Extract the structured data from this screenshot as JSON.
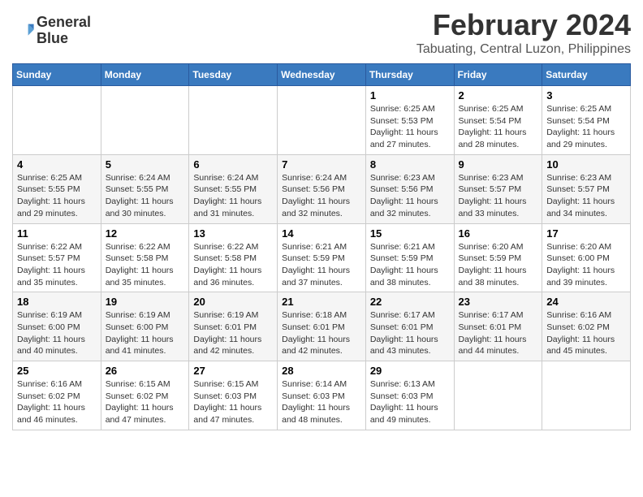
{
  "logo": {
    "line1": "General",
    "line2": "Blue"
  },
  "title": "February 2024",
  "subtitle": "Tabuating, Central Luzon, Philippines",
  "headers": [
    "Sunday",
    "Monday",
    "Tuesday",
    "Wednesday",
    "Thursday",
    "Friday",
    "Saturday"
  ],
  "weeks": [
    [
      {
        "day": "",
        "info": ""
      },
      {
        "day": "",
        "info": ""
      },
      {
        "day": "",
        "info": ""
      },
      {
        "day": "",
        "info": ""
      },
      {
        "day": "1",
        "info": "Sunrise: 6:25 AM\nSunset: 5:53 PM\nDaylight: 11 hours\nand 27 minutes."
      },
      {
        "day": "2",
        "info": "Sunrise: 6:25 AM\nSunset: 5:54 PM\nDaylight: 11 hours\nand 28 minutes."
      },
      {
        "day": "3",
        "info": "Sunrise: 6:25 AM\nSunset: 5:54 PM\nDaylight: 11 hours\nand 29 minutes."
      }
    ],
    [
      {
        "day": "4",
        "info": "Sunrise: 6:25 AM\nSunset: 5:55 PM\nDaylight: 11 hours\nand 29 minutes."
      },
      {
        "day": "5",
        "info": "Sunrise: 6:24 AM\nSunset: 5:55 PM\nDaylight: 11 hours\nand 30 minutes."
      },
      {
        "day": "6",
        "info": "Sunrise: 6:24 AM\nSunset: 5:55 PM\nDaylight: 11 hours\nand 31 minutes."
      },
      {
        "day": "7",
        "info": "Sunrise: 6:24 AM\nSunset: 5:56 PM\nDaylight: 11 hours\nand 32 minutes."
      },
      {
        "day": "8",
        "info": "Sunrise: 6:23 AM\nSunset: 5:56 PM\nDaylight: 11 hours\nand 32 minutes."
      },
      {
        "day": "9",
        "info": "Sunrise: 6:23 AM\nSunset: 5:57 PM\nDaylight: 11 hours\nand 33 minutes."
      },
      {
        "day": "10",
        "info": "Sunrise: 6:23 AM\nSunset: 5:57 PM\nDaylight: 11 hours\nand 34 minutes."
      }
    ],
    [
      {
        "day": "11",
        "info": "Sunrise: 6:22 AM\nSunset: 5:57 PM\nDaylight: 11 hours\nand 35 minutes."
      },
      {
        "day": "12",
        "info": "Sunrise: 6:22 AM\nSunset: 5:58 PM\nDaylight: 11 hours\nand 35 minutes."
      },
      {
        "day": "13",
        "info": "Sunrise: 6:22 AM\nSunset: 5:58 PM\nDaylight: 11 hours\nand 36 minutes."
      },
      {
        "day": "14",
        "info": "Sunrise: 6:21 AM\nSunset: 5:59 PM\nDaylight: 11 hours\nand 37 minutes."
      },
      {
        "day": "15",
        "info": "Sunrise: 6:21 AM\nSunset: 5:59 PM\nDaylight: 11 hours\nand 38 minutes."
      },
      {
        "day": "16",
        "info": "Sunrise: 6:20 AM\nSunset: 5:59 PM\nDaylight: 11 hours\nand 38 minutes."
      },
      {
        "day": "17",
        "info": "Sunrise: 6:20 AM\nSunset: 6:00 PM\nDaylight: 11 hours\nand 39 minutes."
      }
    ],
    [
      {
        "day": "18",
        "info": "Sunrise: 6:19 AM\nSunset: 6:00 PM\nDaylight: 11 hours\nand 40 minutes."
      },
      {
        "day": "19",
        "info": "Sunrise: 6:19 AM\nSunset: 6:00 PM\nDaylight: 11 hours\nand 41 minutes."
      },
      {
        "day": "20",
        "info": "Sunrise: 6:19 AM\nSunset: 6:01 PM\nDaylight: 11 hours\nand 42 minutes."
      },
      {
        "day": "21",
        "info": "Sunrise: 6:18 AM\nSunset: 6:01 PM\nDaylight: 11 hours\nand 42 minutes."
      },
      {
        "day": "22",
        "info": "Sunrise: 6:17 AM\nSunset: 6:01 PM\nDaylight: 11 hours\nand 43 minutes."
      },
      {
        "day": "23",
        "info": "Sunrise: 6:17 AM\nSunset: 6:01 PM\nDaylight: 11 hours\nand 44 minutes."
      },
      {
        "day": "24",
        "info": "Sunrise: 6:16 AM\nSunset: 6:02 PM\nDaylight: 11 hours\nand 45 minutes."
      }
    ],
    [
      {
        "day": "25",
        "info": "Sunrise: 6:16 AM\nSunset: 6:02 PM\nDaylight: 11 hours\nand 46 minutes."
      },
      {
        "day": "26",
        "info": "Sunrise: 6:15 AM\nSunset: 6:02 PM\nDaylight: 11 hours\nand 47 minutes."
      },
      {
        "day": "27",
        "info": "Sunrise: 6:15 AM\nSunset: 6:03 PM\nDaylight: 11 hours\nand 47 minutes."
      },
      {
        "day": "28",
        "info": "Sunrise: 6:14 AM\nSunset: 6:03 PM\nDaylight: 11 hours\nand 48 minutes."
      },
      {
        "day": "29",
        "info": "Sunrise: 6:13 AM\nSunset: 6:03 PM\nDaylight: 11 hours\nand 49 minutes."
      },
      {
        "day": "",
        "info": ""
      },
      {
        "day": "",
        "info": ""
      }
    ]
  ]
}
